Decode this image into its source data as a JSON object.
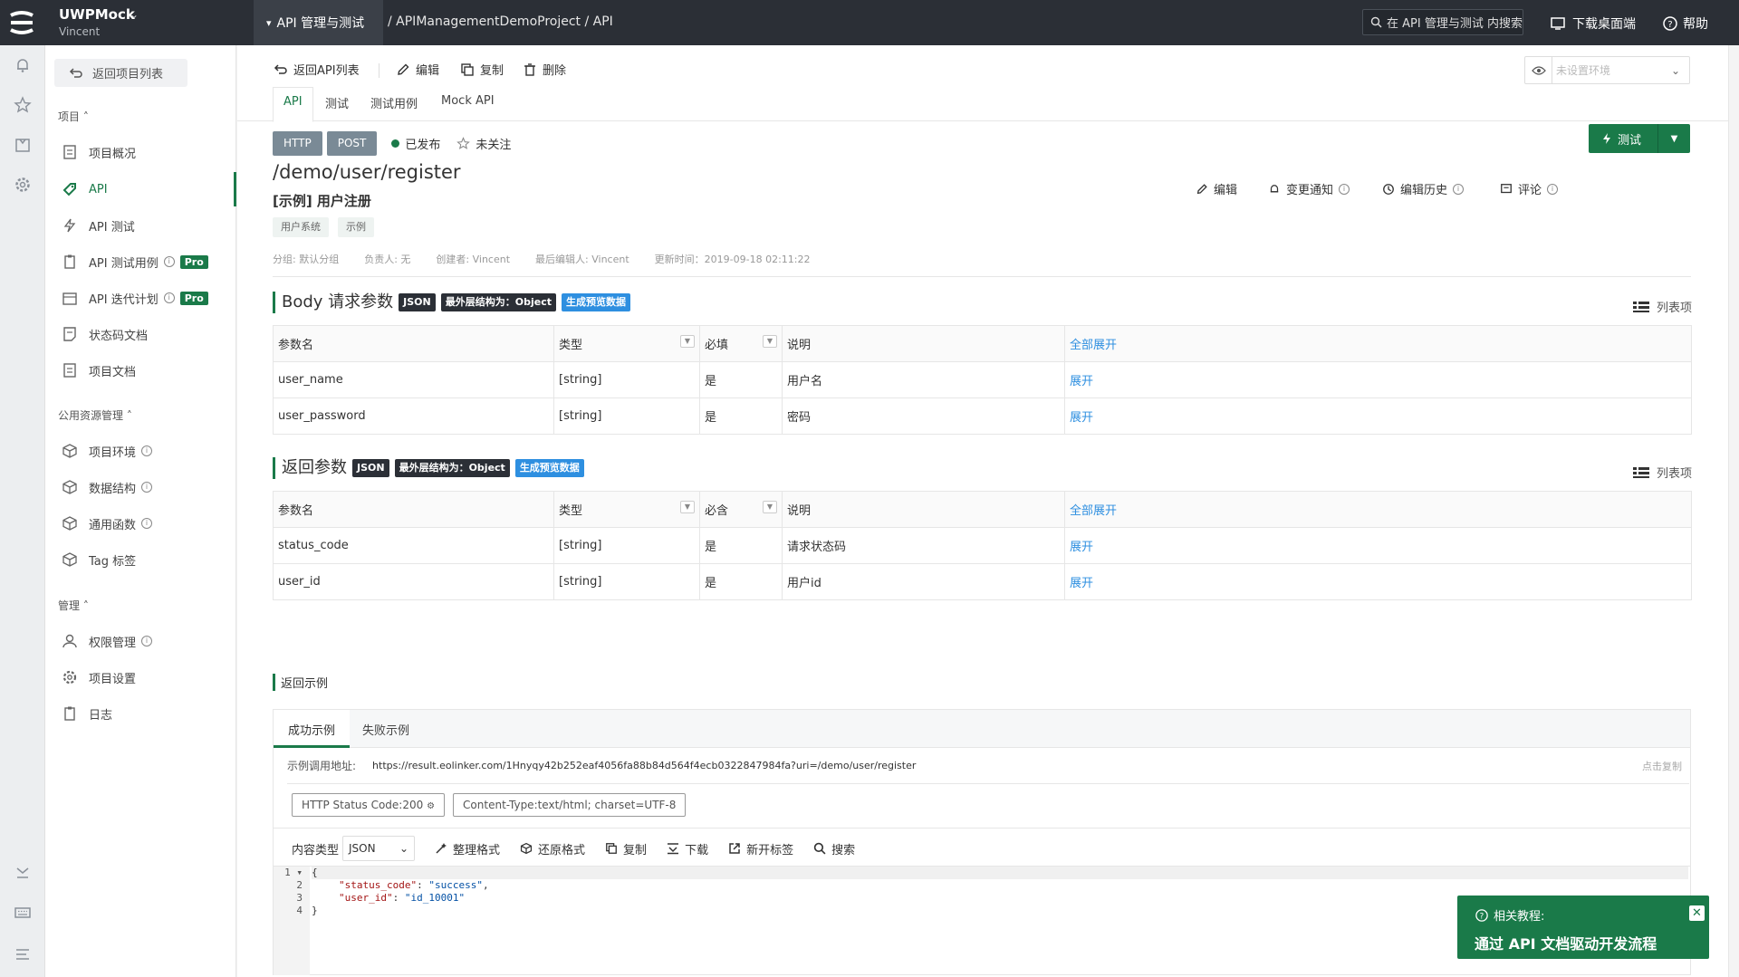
{
  "topbar": {
    "app_name": "UWPMock",
    "user": "Vincent",
    "active_module": "API 管理与测试",
    "breadcrumb": "/ APIManagementDemoProject / API",
    "search_placeholder": "在 API 管理与测试 内搜索",
    "download": "下载桌面端",
    "help": "帮助"
  },
  "sidebar": {
    "back": "返回项目列表",
    "section_project": "项目",
    "project_items": [
      {
        "label": "项目概况"
      },
      {
        "label": "API"
      },
      {
        "label": "API 测试"
      },
      {
        "label": "API 测试用例",
        "badge": "Pro"
      },
      {
        "label": "API 迭代计划",
        "badge": "Pro"
      },
      {
        "label": "状态码文档"
      },
      {
        "label": "项目文档"
      }
    ],
    "section_resources": "公用资源管理",
    "resource_items": [
      {
        "label": "项目环境"
      },
      {
        "label": "数据结构"
      },
      {
        "label": "通用函数"
      },
      {
        "label": "Tag 标签"
      }
    ],
    "section_manage": "管理",
    "manage_items": [
      {
        "label": "权限管理"
      },
      {
        "label": "项目设置"
      },
      {
        "label": "日志"
      }
    ]
  },
  "toolbar": {
    "back": "返回API列表",
    "edit": "编辑",
    "copy": "复制",
    "delete": "删除",
    "env_placeholder": "未设置环境"
  },
  "tabs": [
    "API",
    "测试",
    "测试用例",
    "Mock API"
  ],
  "api": {
    "protocol": "HTTP",
    "method": "POST",
    "status": "已发布",
    "follow": "未关注",
    "actions": {
      "edit": "编辑",
      "notify": "变更通知",
      "history": "编辑历史",
      "comment": "评论",
      "test": "测试"
    },
    "path": "/demo/user/register",
    "name": "[示例] 用户注册",
    "tags": [
      "用户系统",
      "示例"
    ],
    "meta": [
      "分组: 默认分组",
      "负责人: 无",
      "创建者: Vincent",
      "最后编辑人: Vincent",
      "更新时间：2019-09-18 02:11:22"
    ]
  },
  "body_params": {
    "title": "Body 请求参数",
    "badge_json": "JSON",
    "badge_struct": "最外层结构为：Object",
    "badge_gen": "生成预览数据",
    "list_view": "列表项",
    "headers": [
      "参数名",
      "类型",
      "必填",
      "说明",
      "全部展开"
    ],
    "rows": [
      {
        "name": "user_name",
        "type": "[string]",
        "required": "是",
        "desc": "用户名",
        "action": "展开"
      },
      {
        "name": "user_password",
        "type": "[string]",
        "required": "是",
        "desc": "密码",
        "action": "展开"
      }
    ]
  },
  "response_params": {
    "title": "返回参数",
    "badge_json": "JSON",
    "badge_struct": "最外层结构为：Object",
    "badge_gen": "生成预览数据",
    "list_view": "列表项",
    "headers": [
      "参数名",
      "类型",
      "必含",
      "说明",
      "全部展开"
    ],
    "rows": [
      {
        "name": "status_code",
        "type": "[string]",
        "required": "是",
        "desc": "请求状态码",
        "action": "展开"
      },
      {
        "name": "user_id",
        "type": "[string]",
        "required": "是",
        "desc": "用户id",
        "action": "展开"
      }
    ]
  },
  "example": {
    "section_title": "返回示例",
    "tabs": [
      "成功示例",
      "失败示例"
    ],
    "url_label": "示例调用地址:",
    "url": "https://result.eolinker.com/1Hnyqy42b252eaf4056fa88b84d564f4ecb0322847984fa?uri=/demo/user/register",
    "copy_hint": "点击复制",
    "status_pill": "HTTP Status Code:200",
    "content_type_pill": "Content-Type:text/html; charset=UTF-8",
    "content_type_label": "内容类型",
    "content_type_value": "JSON",
    "tools": [
      "整理格式",
      "还原格式",
      "复制",
      "下载",
      "新开标签",
      "搜索"
    ],
    "line_numbers": [
      "1",
      "2",
      "3",
      "4"
    ],
    "code": {
      "open": "{",
      "key1": "\"status_code\"",
      "val1": "\"success\"",
      "key2": "\"user_id\"",
      "val2": "\"id_10001\"",
      "close": "}"
    }
  },
  "toast": {
    "label": "相关教程:",
    "title": "通过 API 文档驱动开发流程"
  },
  "colors": {
    "brand": "#1a7a49",
    "topbar": "#2b2f36",
    "link": "#2e8fe0"
  }
}
